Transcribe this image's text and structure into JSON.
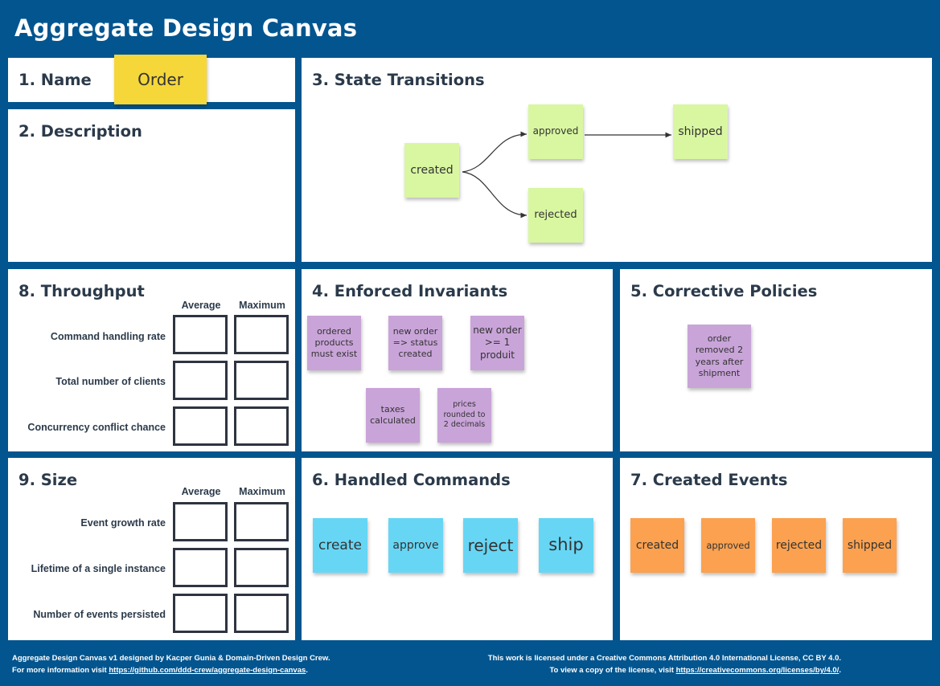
{
  "title": "Aggregate Design Canvas",
  "panels": {
    "name": {
      "title": "1. Name",
      "value": "Order"
    },
    "description": {
      "title": "2. Description"
    },
    "state_transitions": {
      "title": "3. State Transitions",
      "states": {
        "created": "created",
        "approved": "approved",
        "shipped": "shipped",
        "rejected": "rejected"
      }
    },
    "invariants": {
      "title": "4. Enforced Invariants",
      "items": [
        "ordered products must exist",
        "new order => status created",
        "new order >= 1 produit",
        "taxes calculated",
        "prices rounded to 2 decimals"
      ]
    },
    "policies": {
      "title": "5. Corrective Policies",
      "items": [
        "order removed 2 years after shipment"
      ]
    },
    "commands": {
      "title": "6. Handled Commands",
      "items": [
        "create",
        "approve",
        "reject",
        "ship"
      ]
    },
    "events": {
      "title": "7. Created Events",
      "items": [
        "created",
        "approved",
        "rejected",
        "shipped"
      ]
    },
    "throughput": {
      "title": "8. Throughput",
      "columns": [
        "Average",
        "Maximum"
      ],
      "rows": [
        "Command handling rate",
        "Total number of clients",
        "Concurrency conflict chance"
      ]
    },
    "size": {
      "title": "9. Size",
      "columns": [
        "Average",
        "Maximum"
      ],
      "rows": [
        "Event growth rate",
        "Lifetime of a single instance",
        "Number of events persisted"
      ]
    }
  },
  "footer": {
    "left_line1": "Aggregate Design Canvas v1 designed by Kacper Gunia & Domain-Driven Design Crew.",
    "left_line2_prefix": "For more information visit ",
    "left_link": "https://github.com/ddd-crew/aggregate-design-canvas",
    "left_line2_suffix": ".",
    "right_line1": "This work is licensed under a Creative Commons Attribution 4.0 International License, CC BY 4.0.",
    "right_line2_prefix": "To view a copy of the license, visit ",
    "right_link": "https://creativecommons.org/licenses/by/4.0/",
    "right_line2_suffix": "."
  },
  "colors": {
    "frame": "#03558f",
    "sticky_yellow": "#f5d73a",
    "sticky_green": "#d9f7a1",
    "sticky_purple": "#c9a4d9",
    "sticky_blue": "#67d6f5",
    "sticky_orange": "#fba14f"
  }
}
